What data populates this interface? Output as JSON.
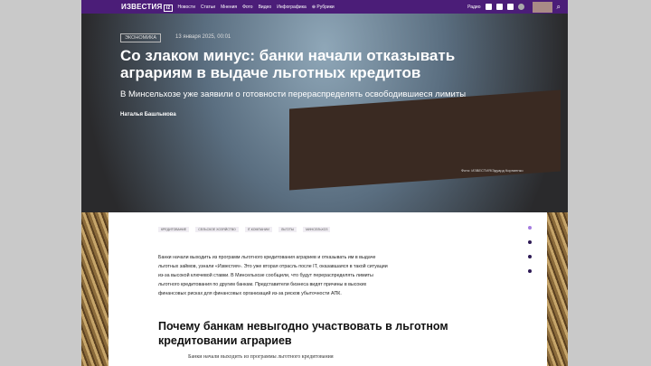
{
  "nav": {
    "logo": "ИЗВЕСТИЯ",
    "logo_box": "iz",
    "items": [
      "Новости",
      "Статьи",
      "Мнения",
      "Фото",
      "Видео",
      "Инфографика",
      "⊕ Рубрики"
    ],
    "radio": "Радио"
  },
  "hero": {
    "rubric": "ЭКОНОМИКА",
    "date": "13 января 2025, 00:01",
    "title": "Со злаком минус: банки начали отказывать аграриям в выдаче льготных кредитов",
    "lead": "В Минсельхозе уже заявили о готовности перераспределять освободившиеся лимиты",
    "author": "Наталья Башлыкова",
    "photo_credit": "Фото: ИЗВЕСТИЯ/Эдуард Корниенко"
  },
  "article": {
    "tags": [
      "КРЕДИТОВАНИЕ",
      "СЕЛЬСКОЕ ХОЗЯЙСТВО",
      "IT-КОМПАНИИ",
      "ЛЬГОТЫ",
      "МИНСЕЛЬХОЗ"
    ],
    "paragraph": "Банки начали выходить из программ льготного кредитования аграриев и отказывать им в выдаче льготных займов, узнали «Известия». Это уже вторая отрасль после IT, оказавшаяся в такой ситуации из-за высокой ключевой ставки. В Минсельхозе сообщили, что будут перераспределять лимиты льготного кредитования по другим банкам. Представители бизнеса видят причины в высоких финансовых рисках для финансовых организаций из-за рисков убыточности АПК.",
    "subheading": "Почему банкам невыгодно участвовать в льготном кредитовании аграриев",
    "paragraph2": "Банки начали выходить из программы льготного кредитования"
  }
}
